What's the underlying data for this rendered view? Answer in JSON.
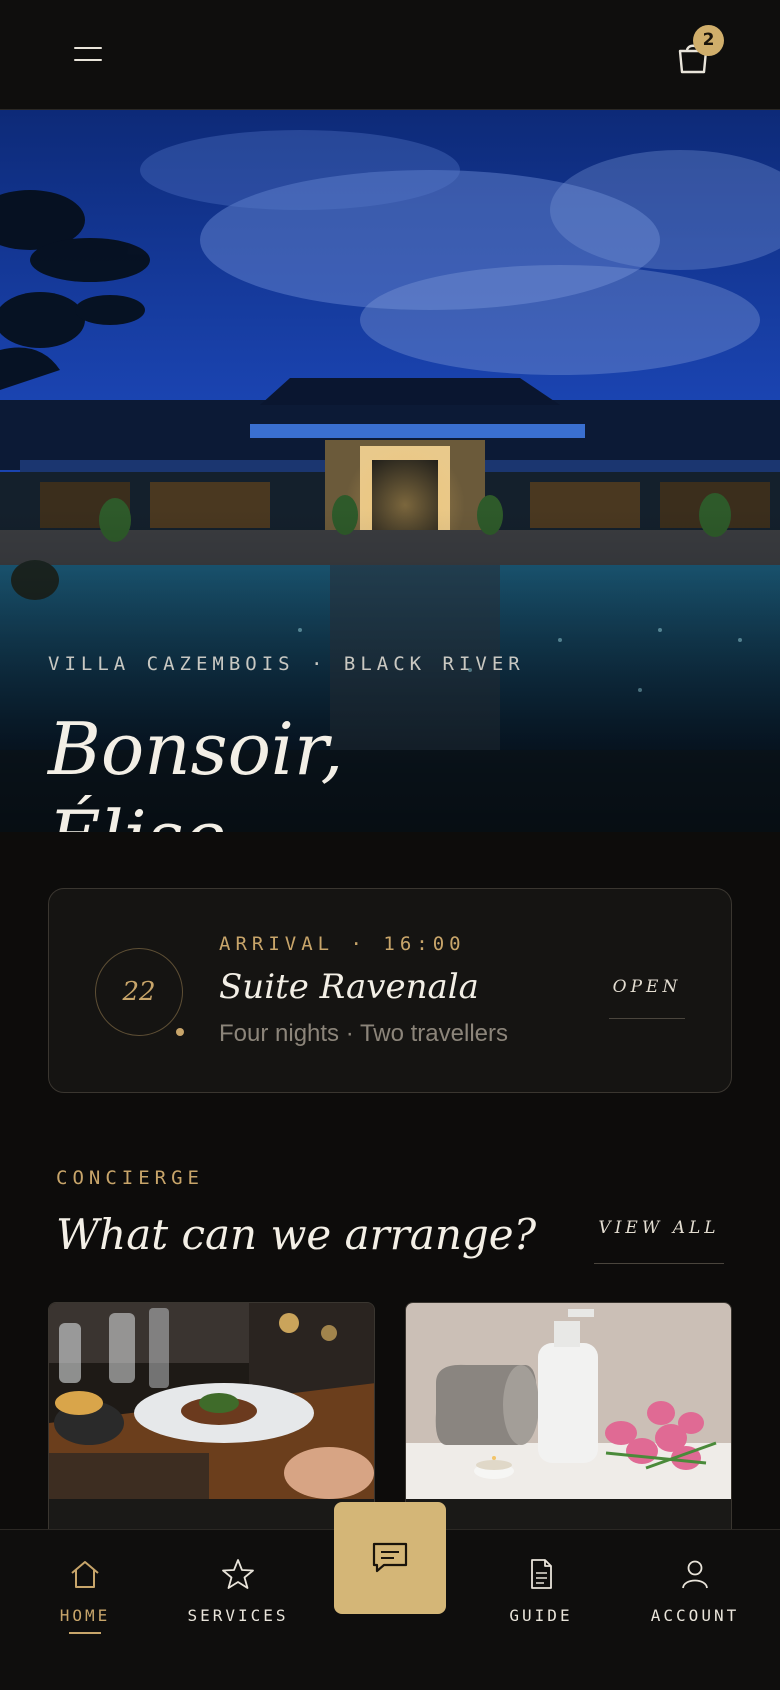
{
  "header": {
    "menu_icon": "hamburger-menu-icon",
    "bag_icon": "shopping-bag-icon",
    "bag_count": "2"
  },
  "hero": {
    "location": "VILLA CAZEMBOIS · BLACK RIVER",
    "greeting_line1": "Bonsoir,",
    "greeting_line2": "Élise."
  },
  "arrival": {
    "day": "22",
    "meta": "ARRIVAL · 16:00",
    "suite": "Suite Ravenala",
    "details": "Four nights · Two travellers",
    "open_label": "OPEN"
  },
  "concierge": {
    "eyebrow": "CONCIERGE",
    "title": "What can we arrange?",
    "view_all": "VIEW ALL"
  },
  "bottom_nav": {
    "items": [
      {
        "label": "HOME",
        "icon": "home-icon",
        "active": true
      },
      {
        "label": "SERVICES",
        "icon": "star-icon",
        "active": false
      },
      {
        "label": "GUIDE",
        "icon": "document-icon",
        "active": false
      },
      {
        "label": "ACCOUNT",
        "icon": "user-icon",
        "active": false
      }
    ],
    "center_action_icon": "chat-icon"
  },
  "colors": {
    "background": "#0d0c0b",
    "accent_gold": "#c8a56a",
    "fab_gold": "#d4b677",
    "card_border": "#3a3630"
  }
}
